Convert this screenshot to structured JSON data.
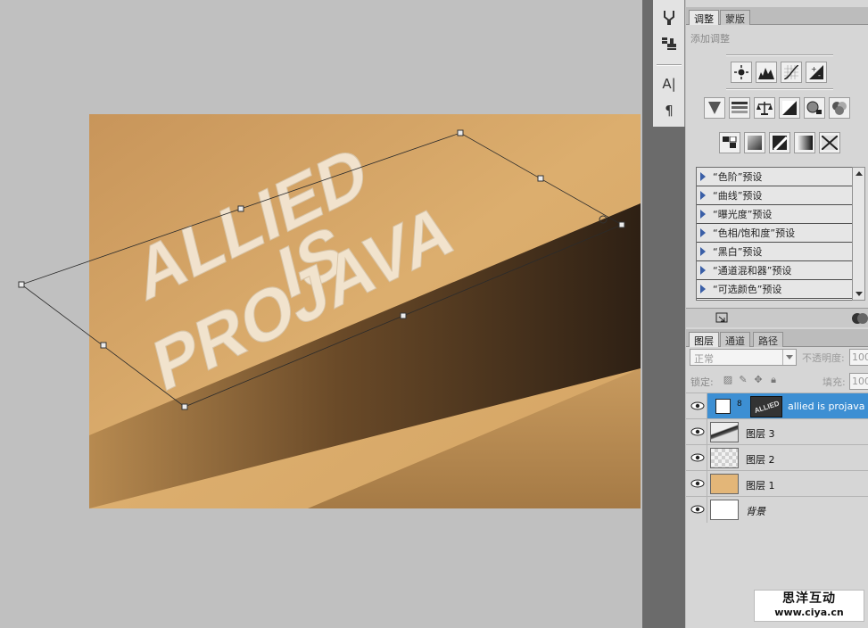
{
  "canvas": {
    "text_lines": [
      "ALLIED",
      "IS",
      "PROJAVA"
    ],
    "colors": {
      "cardboard": "#d4a565",
      "text": "#f4e8d6",
      "shadow": "#3a2a18"
    }
  },
  "tool_strip": {
    "icons": [
      "brush-preset-icon",
      "clone-source-icon",
      "character-icon",
      "paragraph-icon"
    ],
    "character_glyph": "A|",
    "paragraph_glyph": "¶"
  },
  "adjustments_panel": {
    "tabs": [
      "调整",
      "蒙版"
    ],
    "hint": "添加调整",
    "presets": [
      "“色阶”预设",
      "“曲线”预设",
      "“曝光度”预设",
      "“色相/饱和度”预设",
      "“黑白”预设",
      "“通道混和器”预设",
      "“可选颜色”预设"
    ]
  },
  "layers_panel": {
    "tabs": [
      "图层",
      "通道",
      "路径"
    ],
    "blend_mode": "正常",
    "opacity_label": "不透明度:",
    "opacity_value": "100",
    "lock_label": "锁定:",
    "fill_label": "填充:",
    "fill_value": "100",
    "layers": [
      {
        "name": "allied is projava",
        "selected": true
      },
      {
        "name": "图层 3",
        "selected": false
      },
      {
        "name": "图层 2",
        "selected": false
      },
      {
        "name": "图层 1",
        "selected": false
      },
      {
        "name": "背景",
        "selected": false
      }
    ]
  },
  "watermark": {
    "title": "思洋互动",
    "url": "www.ciya.cn"
  },
  "colors": {
    "selection_blue": "#3d8fd3",
    "panel_gray": "#d6d6d6",
    "workspace_gray": "#c0c0c0"
  }
}
